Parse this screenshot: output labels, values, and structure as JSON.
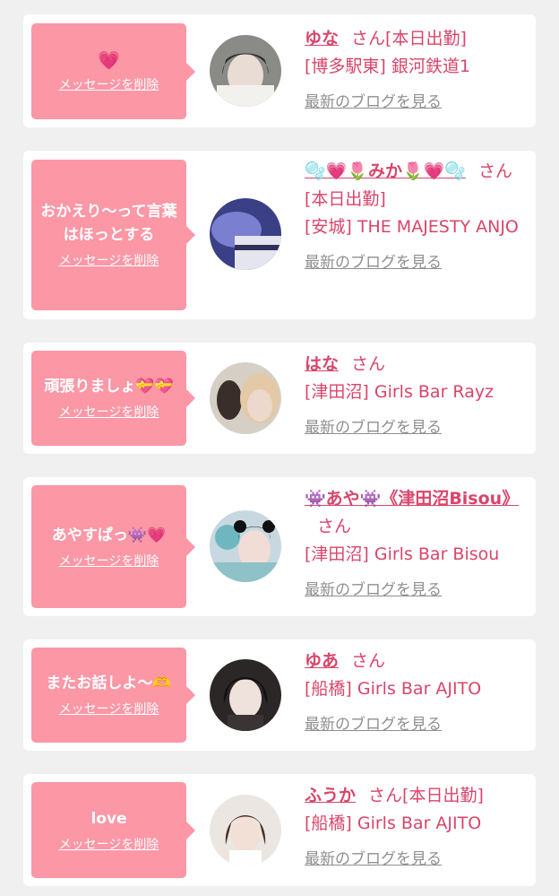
{
  "common": {
    "delete_label": "メッセージを削除",
    "blog_label": "最新のブログを見る",
    "san": "さん"
  },
  "cards": [
    {
      "message": "💗",
      "name": "ゆな",
      "status": "[本日出勤]",
      "shop": "[博多駅東] 銀河鉄道1"
    },
    {
      "message": "おかえり〜って言葉はほっとする",
      "name": "🫧💗🌷みか🌷💗🫧",
      "status": "[本日出勤]",
      "shop": "[安城] THE MAJESTY ANJO"
    },
    {
      "message": "頑張りましょ💝💝",
      "name": "はな",
      "status": "",
      "shop": "[津田沼] Girls Bar Rayz"
    },
    {
      "message": "あやすぱっ👾💗",
      "name": "👾あや👾《津田沼Bisou》",
      "status": "",
      "shop": "[津田沼] Girls Bar Bisou"
    },
    {
      "message": "またお話しよ〜🫶",
      "name": "ゆあ",
      "status": "",
      "shop": "[船橋] Girls Bar AJITO"
    },
    {
      "message": "love",
      "name": "ふうか",
      "status": "[本日出勤]",
      "shop": "[船橋] Girls Bar AJITO"
    }
  ],
  "colors": {
    "accent": "#d9456a",
    "bubble": "#fc97a6",
    "link_gray": "#8f8f8f",
    "background": "#f0f0f0"
  }
}
